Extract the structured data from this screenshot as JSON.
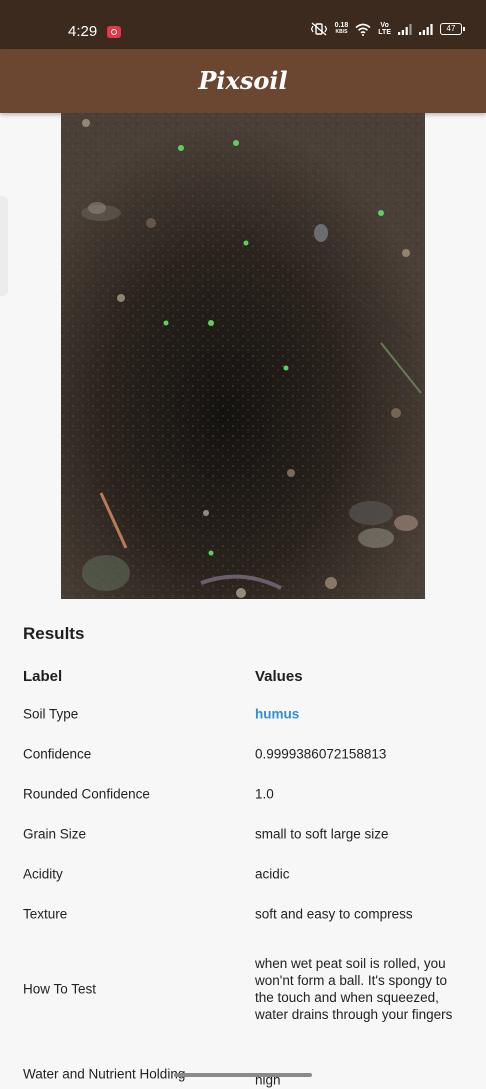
{
  "status_bar": {
    "time": "4:29",
    "net_speed_value": "0.18",
    "net_speed_unit": "KB/S",
    "volte_label_top": "Vo",
    "volte_label_bottom": "LTE",
    "battery_level": "47",
    "icons": [
      "screen-record-icon",
      "vibrate-icon",
      "wifi-icon",
      "volte-icon",
      "signal-icon",
      "signal-icon",
      "battery-icon"
    ]
  },
  "app": {
    "title": "Pixsoil"
  },
  "photo": {
    "description_icon": "soil-photo"
  },
  "results": {
    "title": "Results",
    "header": {
      "label": "Label",
      "values": "Values"
    },
    "rows": [
      {
        "label": "Soil Type",
        "value": "humus"
      },
      {
        "label": "Confidence",
        "value": "0.9999386072158813"
      },
      {
        "label": "Rounded Confidence",
        "value": "1.0"
      },
      {
        "label": "Grain Size",
        "value": "small to soft large size"
      },
      {
        "label": "Acidity",
        "value": "acidic"
      },
      {
        "label": "Texture",
        "value": "soft and easy to compress"
      },
      {
        "label": "How To Test",
        "value": "when wet peat soil is rolled, you won'nt form a ball. It's spongy to the touch and when squeezed, water drains through your fingers"
      },
      {
        "label": "Water and Nutrient Holding",
        "value": "high"
      }
    ]
  },
  "colors": {
    "status_bar": "#3d2a1e",
    "app_bar": "#6b4630",
    "link": "#2f8fd8",
    "background": "#f7f7f8"
  }
}
